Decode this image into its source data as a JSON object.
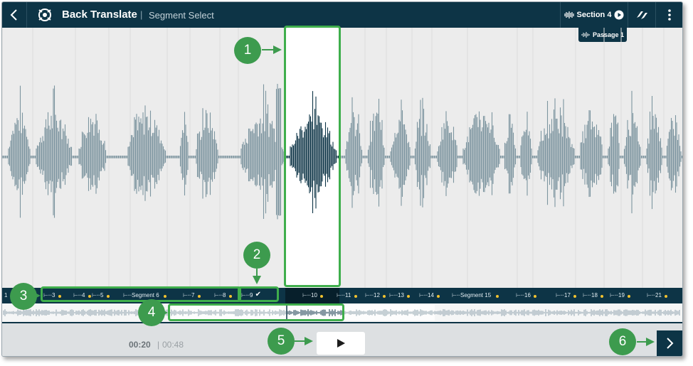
{
  "header": {
    "app_title": "Back Translate",
    "separator": "|",
    "page_subtitle": "Segment Select",
    "section_label": "Section 4",
    "passage_label": "Passage 1"
  },
  "segments": [
    {
      "label": "1",
      "dot": true
    },
    {
      "label": "3",
      "dot": true
    },
    {
      "label": "4",
      "dot": true
    },
    {
      "label": "5",
      "dot": true
    },
    {
      "label": "Segment 6",
      "dot": true
    },
    {
      "label": "7",
      "dot": true
    },
    {
      "label": "8",
      "dot": true
    },
    {
      "label": "9",
      "dot": false,
      "check": true
    },
    {
      "label": "10",
      "dot": true
    },
    {
      "label": "11",
      "dot": true
    },
    {
      "label": "12",
      "dot": true
    },
    {
      "label": "13",
      "dot": true
    },
    {
      "label": "14",
      "dot": true
    },
    {
      "label": "Segment 15",
      "dot": true
    },
    {
      "label": "16",
      "dot": true
    },
    {
      "label": "17",
      "dot": true
    },
    {
      "label": "18",
      "dot": true
    },
    {
      "label": "19",
      "dot": true
    },
    {
      "label": "21",
      "dot": true
    }
  ],
  "playback": {
    "current_time": "00:20",
    "time_separator": "|",
    "total_time": "00:48"
  },
  "callouts": [
    "1",
    "2",
    "3",
    "4",
    "5",
    "6"
  ],
  "icons": {
    "back": "chevron-left-icon",
    "logo": "app-logo-icon",
    "section": "waveform-icon",
    "section_play": "play-circle-icon",
    "sync": "sync-icon",
    "more": "kebab-menu-icon",
    "play": "play-icon",
    "next": "chevron-right-icon"
  },
  "colors": {
    "header_bg": "#0d3446",
    "waveform": "#7d95a0",
    "selected_waveform": "#0d3446",
    "callout_green": "#3d9b4e",
    "segment_dot": "#f2c230"
  }
}
